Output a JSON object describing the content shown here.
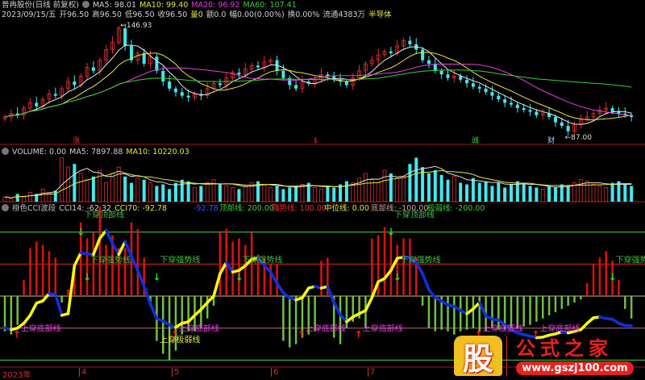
{
  "header": {
    "stock_name": "普冉股份(日线 前复权)",
    "ma5": "MA5: 98.01",
    "ma10": "MA10: 99.40",
    "ma20": "MA20: 96.92",
    "ma60": "MA60: 107.41",
    "date": "2023/09/15/五",
    "open": "开96.50",
    "high": "高96.50",
    "low": "低96.50",
    "close": "收96.50",
    "volume": "量0",
    "amount": "额0.0",
    "change": "幅0.00(0.00%)",
    "turnover": "换0.00%",
    "float": "流通4383万",
    "sector": "半导体"
  },
  "price_marks": {
    "high_label": "146.93",
    "low_label": "87.00",
    "events": [
      {
        "i": 11,
        "text": "涨"
      },
      {
        "i": 49,
        "text": "$"
      },
      {
        "i": 74,
        "text": "诚"
      },
      {
        "i": 86,
        "text": "财"
      }
    ]
  },
  "volume_header": {
    "title": "VOLUME: 0.00",
    "ma5": "MA5: 7897.88",
    "ma10": "MA10: 10220.03"
  },
  "cci_header": {
    "title": "褂色CCI波段",
    "cci14": "CCI14: -62.32",
    "cci70": "CCI70: -92.78",
    "cur": "-92.78",
    "top": "顶部线: 200.00",
    "strong": "强势线: 100.00",
    "mid": "中位线: 0.00",
    "bottom": "底部线: -100.00",
    "weak": "极弱线: -200.00"
  },
  "axis": {
    "labels": [
      {
        "text": "2023年",
        "i": 0
      },
      {
        "text": "4",
        "i": 12
      },
      {
        "text": "5",
        "i": 27
      },
      {
        "text": "6",
        "i": 42
      },
      {
        "text": "7",
        "i": 58
      }
    ]
  },
  "watermark": {
    "logo": "股",
    "name": "公式之家",
    "url": "www.gszj100.com"
  },
  "colors": {
    "up": "#e03030",
    "down": "#40e8f0",
    "ma5": "#e8e8e8",
    "ma10": "#e6e63c",
    "ma20": "#e040e0",
    "ma60": "#3ccc3c",
    "cci_up": "#ffff00",
    "cci_down": "#1030e0"
  },
  "chart_data": {
    "type": "line",
    "title": "普冉股份(日线 前复权)",
    "price": {
      "ylim": [
        85,
        150
      ],
      "close": [
        96,
        98,
        97,
        101,
        104,
        102,
        106,
        109,
        108,
        112,
        116,
        114,
        119,
        124,
        122,
        128,
        134,
        138,
        146,
        136,
        128,
        132,
        126,
        130,
        122,
        116,
        112,
        110,
        108,
        107,
        109,
        108,
        112,
        115,
        114,
        118,
        121,
        120,
        123,
        125,
        124,
        127,
        128,
        122,
        118,
        114,
        112,
        116,
        115,
        117,
        120,
        119,
        117,
        116,
        114,
        118,
        122,
        126,
        128,
        131,
        133,
        132,
        136,
        139,
        137,
        134,
        128,
        126,
        122,
        120,
        118,
        119,
        117,
        115,
        113,
        112,
        110,
        108,
        106,
        104,
        103,
        101,
        100,
        99,
        97,
        98,
        96,
        93,
        91,
        88,
        92,
        95,
        96,
        98,
        100,
        101,
        99,
        98,
        97,
        96
      ]
    },
    "volume": {
      "unit": "thousand",
      "values": [
        3,
        2,
        5,
        3,
        6,
        5,
        8,
        6,
        7,
        28,
        22,
        24,
        18,
        14,
        16,
        20,
        12,
        18,
        22,
        16,
        12,
        15,
        14,
        12,
        10,
        11,
        8,
        12,
        14,
        13,
        9,
        10,
        12,
        14,
        11,
        10,
        9,
        8,
        10,
        12,
        13,
        11,
        9,
        10,
        8,
        9,
        10,
        11,
        12,
        9,
        8,
        10,
        9,
        11,
        13,
        12,
        15,
        18,
        14,
        12,
        20,
        18,
        15,
        16,
        24,
        28,
        22,
        18,
        20,
        17,
        14,
        16,
        12,
        11,
        15,
        12,
        13,
        10,
        12,
        9,
        11,
        13,
        12,
        10,
        9,
        8,
        10,
        9,
        11,
        10,
        12,
        14,
        13,
        11,
        10,
        9,
        12,
        13,
        11,
        10
      ]
    },
    "cci": {
      "ylim": [
        -220,
        265
      ],
      "levels": [
        200,
        100,
        0,
        -100,
        -200
      ],
      "line": [
        -100,
        -105,
        -100,
        -85,
        -60,
        -22,
        -15,
        8,
        5,
        -60,
        -55,
        95,
        135,
        132,
        130,
        180,
        205,
        165,
        130,
        170,
        125,
        80,
        30,
        -25,
        -70,
        -78,
        -90,
        -97,
        -85,
        -80,
        -60,
        -42,
        -20,
        0,
        70,
        105,
        75,
        80,
        95,
        115,
        118,
        95,
        75,
        40,
        10,
        -5,
        -12,
        -5,
        25,
        30,
        25,
        30,
        -20,
        -58,
        -80,
        -65,
        -55,
        -45,
        -5,
        45,
        55,
        80,
        118,
        122,
        120,
        105,
        70,
        20,
        -5,
        -15,
        -28,
        -32,
        -45,
        -55,
        -40,
        -20,
        -62,
        -72,
        -75,
        -90,
        -105,
        -115,
        -120,
        -125,
        -130,
        -128,
        -122,
        -118,
        -112,
        -115,
        -110,
        -105,
        -85,
        -68,
        -65,
        -70,
        -72,
        -85,
        -92,
        -93
      ],
      "hist": [
        -110,
        -120,
        -90,
        50,
        150,
        170,
        160,
        140,
        120,
        -20,
        20,
        100,
        230,
        180,
        200,
        280,
        160,
        190,
        150,
        150,
        230,
        210,
        120,
        -30,
        -140,
        -180,
        -200,
        -170,
        -120,
        -110,
        -110,
        -100,
        -70,
        -30,
        200,
        210,
        170,
        180,
        160,
        200,
        130,
        120,
        100,
        100,
        -140,
        -160,
        -150,
        -130,
        -120,
        -110,
        110,
        120,
        -130,
        -150,
        -100,
        -80,
        -70,
        -100,
        180,
        190,
        215,
        200,
        160,
        180,
        180,
        120,
        -30,
        -100,
        -110,
        -105,
        -110,
        -120,
        -110,
        -105,
        -100,
        -110,
        -110,
        -100,
        -105,
        -105,
        -100,
        -100,
        -95,
        -90,
        -80,
        -70,
        -60,
        -50,
        -40,
        -30,
        -20,
        -10,
        40,
        100,
        120,
        140,
        110,
        50,
        -40,
        -70
      ]
    },
    "annotations": [
      {
        "text": "上穿底部线",
        "i": 2,
        "v": -100,
        "kind": "up"
      },
      {
        "text": "下穿强势线",
        "i": 13,
        "v": 100,
        "kind": "down"
      },
      {
        "text": "下穿强势线",
        "i": 24,
        "v": 100,
        "kind": "down"
      },
      {
        "text": "下穿顶部线",
        "i": 12,
        "v": 240,
        "kind": "down"
      },
      {
        "text": "上穿底部线",
        "i": 27,
        "v": -100,
        "kind": "up"
      },
      {
        "text": "上穿极弱线",
        "i": 24,
        "v": -150,
        "kind": "weak"
      },
      {
        "text": "下穿强势线",
        "i": 37,
        "v": 100,
        "kind": "down"
      },
      {
        "text": "上穿底部线",
        "i": 47,
        "v": -100,
        "kind": "up"
      },
      {
        "text": "上穿底部线",
        "i": 56,
        "v": -100,
        "kind": "up"
      },
      {
        "text": "下穿顶部线",
        "i": 61,
        "v": 240,
        "kind": "down"
      },
      {
        "text": "下穿强势线",
        "i": 62,
        "v": 100,
        "kind": "down"
      },
      {
        "text": "上穿底部线",
        "i": 75,
        "v": -100,
        "kind": "up"
      },
      {
        "text": "上穿底部线",
        "i": 84,
        "v": -100,
        "kind": "up"
      },
      {
        "text": "下穿强势线",
        "i": 96,
        "v": 100,
        "kind": "down"
      }
    ]
  }
}
